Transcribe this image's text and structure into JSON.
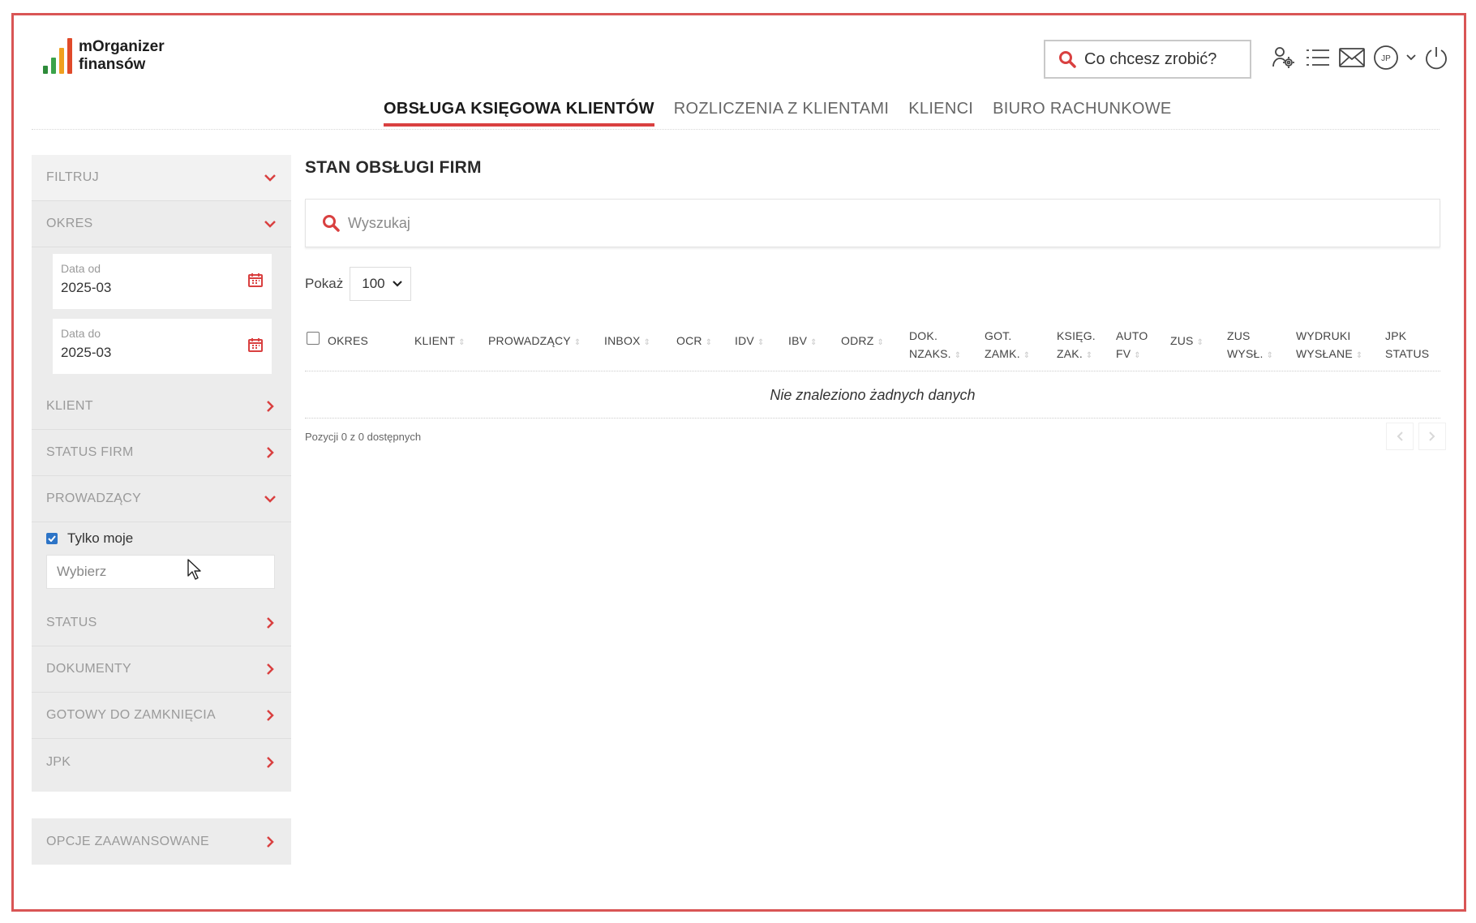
{
  "brand": {
    "line1": "mOrganizer",
    "line2": "finansów",
    "colors": [
      "#2e8b3a",
      "#3aa34a",
      "#f0a020",
      "#e04a2a"
    ]
  },
  "header": {
    "quick_search_label": "Co chcesz zrobić?",
    "icons": [
      "users-settings-icon",
      "menu-list-icon",
      "mail-icon",
      "user-avatar-icon",
      "chevron-down-icon",
      "power-icon"
    ],
    "avatar_initials": "JP"
  },
  "tabs": [
    {
      "label": "OBSŁUGA KSIĘGOWA KLIENTÓW",
      "active": true
    },
    {
      "label": "ROZLICZENIA Z KLIENTAMI",
      "active": false
    },
    {
      "label": "KLIENCI",
      "active": false
    },
    {
      "label": "BIURO RACHUNKOWE",
      "active": false
    }
  ],
  "sidebar": {
    "filter_label": "FILTRUJ",
    "period_label": "OKRES",
    "date_from_label": "Data od",
    "date_from_value": "2025-03",
    "date_to_label": "Data do",
    "date_to_value": "2025-03",
    "client_label": "KLIENT",
    "company_status_label": "STATUS FIRM",
    "manager_label": "PROWADZĄCY",
    "only_mine_label": "Tylko moje",
    "only_mine_checked": true,
    "choose_label": "Wybierz",
    "status_label": "STATUS",
    "documents_label": "DOKUMENTY",
    "ready_to_close_label": "GOTOWY DO ZAMKNIĘCIA",
    "jpk_label": "JPK",
    "advanced_label": "OPCJE ZAAWANSOWANE"
  },
  "main": {
    "title": "STAN OBSŁUGI FIRM",
    "search_placeholder": "Wyszukaj",
    "show_label": "Pokaż",
    "show_value": "100",
    "columns": {
      "okres": "OKRES",
      "klient": "KLIENT",
      "prowadzacy": "PROWADZĄCY",
      "inbox": "INBOX",
      "ocr": "OCR",
      "idv": "IDV",
      "ibv": "IBV",
      "odrz": "ODRZ",
      "dok_1": "DOK.",
      "dok_2": "NZAKS.",
      "got_1": "GOT.",
      "got_2": "ZAMK.",
      "ksieg_1": "KSIĘG.",
      "ksieg_2": "ZAK.",
      "auto_1": "AUTO",
      "auto_2": "FV",
      "zus": "ZUS",
      "zusw_1": "ZUS",
      "zusw_2": "WYSŁ.",
      "wydr_1": "WYDRUKI",
      "wydr_2": "WYSŁANE",
      "jpk_1": "JPK",
      "jpk_2": "STATUS"
    },
    "empty_message": "Nie znaleziono żadnych danych",
    "info_text": "Pozycji 0 z 0 dostępnych"
  },
  "colors": {
    "accent": "#d94040",
    "frame": "#d95555",
    "sidebar_bg": "#ececec",
    "checkbox": "#2d74c7"
  }
}
